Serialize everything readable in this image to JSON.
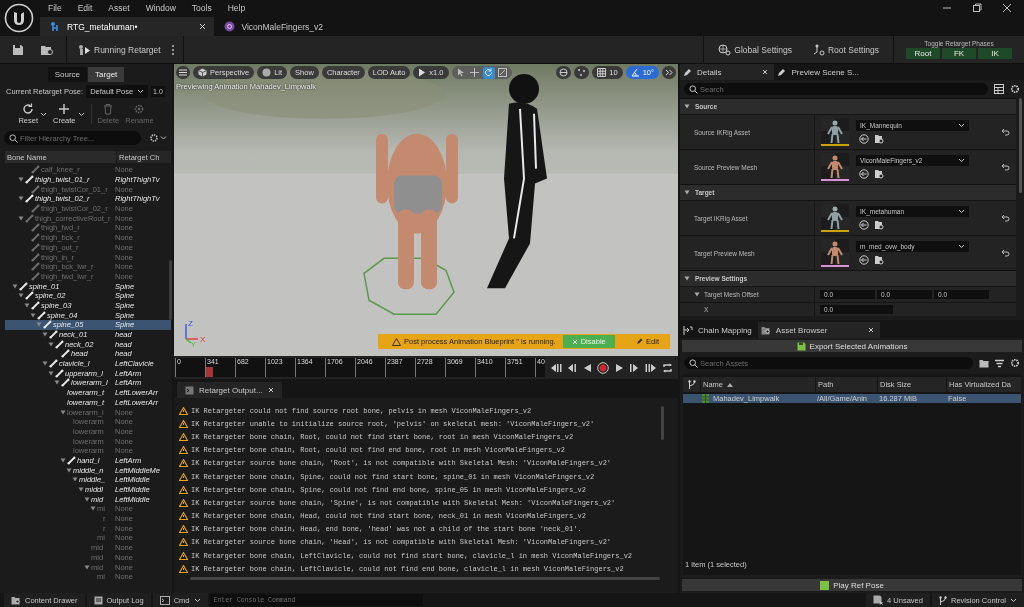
{
  "menu": [
    "File",
    "Edit",
    "Asset",
    "Window",
    "Tools",
    "Help"
  ],
  "doc_tabs": [
    {
      "label": "RTG_metahuman•",
      "selected": true
    },
    {
      "label": "ViconMaleFingers_v2",
      "selected": false
    }
  ],
  "toolbar": {
    "run_button": "Running Retarget",
    "global_settings": "Global Settings",
    "root_settings": "Root Settings",
    "phases_title": "Toggle Retarget Phases",
    "phases": [
      {
        "label": "Root",
        "on": true
      },
      {
        "label": "FK",
        "on": true
      },
      {
        "label": "IK",
        "on": true
      }
    ]
  },
  "left_panel": {
    "modes": [
      {
        "label": "Source",
        "selected": false
      },
      {
        "label": "Target",
        "selected": true
      }
    ],
    "pose_label": "Current Retarget Pose:",
    "pose_value": "Default Pose",
    "pose_scale": "1.0",
    "actions": [
      {
        "label": "Reset",
        "disabled": false
      },
      {
        "label": "Create",
        "disabled": false
      },
      {
        "label": "Delete",
        "disabled": true
      },
      {
        "label": "Rename",
        "disabled": true
      }
    ],
    "filter_placeholder": "Filter Hierarchy Tree...",
    "columns": [
      "Bone Name",
      "Retarget Ch"
    ],
    "tree": [
      {
        "children": [
          {
            "children": [
              {
                "name": "calf_knee_r",
                "chain": "None",
                "mapped": false,
                "icon": true,
                "selected": false
              }
            ]
          },
          {
            "name": "thigh_twist_01_r",
            "chain": "RightThighTv",
            "mapped": true,
            "icon": true,
            "selected": false,
            "children": [
              {
                "name": "thigh_twistCor_01_r",
                "chain": "None",
                "mapped": false,
                "icon": true,
                "selected": false
              }
            ]
          },
          {
            "name": "thigh_twist_02_r",
            "chain": "RightThighTv",
            "mapped": true,
            "icon": true,
            "selected": false,
            "children": [
              {
                "name": "thigh_twistCor_02_r",
                "chain": "None",
                "mapped": false,
                "icon": true,
                "selected": false
              }
            ]
          },
          {
            "name": "thigh_correctiveRoot_r",
            "chain": "None",
            "mapped": false,
            "icon": true,
            "selected": false,
            "children": [
              {
                "name": "thigh_fwd_r",
                "chain": "None",
                "mapped": false,
                "icon": true,
                "selected": false
              },
              {
                "name": "thigh_bck_r",
                "chain": "None",
                "mapped": false,
                "icon": true,
                "selected": false
              },
              {
                "name": "thigh_out_r",
                "chain": "None",
                "mapped": false,
                "icon": true,
                "selected": false
              },
              {
                "name": "thigh_in_r",
                "chain": "None",
                "mapped": false,
                "icon": true,
                "selected": false
              },
              {
                "name": "thigh_bck_lwr_r",
                "chain": "None",
                "mapped": false,
                "icon": true,
                "selected": false
              },
              {
                "name": "thigh_fwd_lwr_r",
                "chain": "None",
                "mapped": false,
                "icon": true,
                "selected": false
              }
            ]
          }
        ]
      },
      {
        "name": "spine_01",
        "chain": "Spine",
        "mapped": true,
        "icon": true,
        "selected": false,
        "children": [
          {
            "name": "spine_02",
            "chain": "Spine",
            "mapped": true,
            "icon": true,
            "selected": false,
            "children": [
              {
                "name": "spine_03",
                "chain": "Spine",
                "mapped": true,
                "icon": true,
                "selected": false,
                "children": [
                  {
                    "name": "spine_04",
                    "chain": "Spine",
                    "mapped": true,
                    "icon": true,
                    "selected": false,
                    "children": [
                      {
                        "name": "spine_05",
                        "chain": "Spine",
                        "mapped": true,
                        "icon": true,
                        "selected": true,
                        "children": [
                          {
                            "name": "neck_01",
                            "chain": "head",
                            "mapped": true,
                            "icon": true,
                            "selected": false,
                            "children": [
                              {
                                "name": "neck_02",
                                "chain": "head",
                                "mapped": true,
                                "icon": true,
                                "selected": false,
                                "children": [
                                  {
                                    "name": "head",
                                    "chain": "head",
                                    "mapped": true,
                                    "icon": true,
                                    "selected": false
                                  }
                                ]
                              }
                            ]
                          },
                          {
                            "name": "clavicle_l",
                            "chain": "LeftClavicle",
                            "mapped": true,
                            "icon": true,
                            "selected": false,
                            "children": [
                              {
                                "name": "upperarm_l",
                                "chain": "LeftArm",
                                "mapped": true,
                                "icon": true,
                                "selected": false,
                                "children": [
                                  {
                                    "name": "lowerarm_l",
                                    "chain": "LeftArm",
                                    "mapped": true,
                                    "icon": true,
                                    "selected": false,
                                    "children": [
                                      {
                                        "name": "lowerarm_t",
                                        "chain": "LeftLowerArr",
                                        "mapped": true,
                                        "icon": false,
                                        "selected": false
                                      },
                                      {
                                        "name": "lowerarm_t",
                                        "chain": "LeftLowerArr",
                                        "mapped": true,
                                        "icon": false,
                                        "selected": false
                                      },
                                      {
                                        "name": "lowerarm_i",
                                        "chain": "None",
                                        "mapped": false,
                                        "icon": false,
                                        "selected": false,
                                        "children": [
                                          {
                                            "name": "lowerarm",
                                            "chain": "None",
                                            "mapped": false,
                                            "icon": false,
                                            "selected": false
                                          },
                                          {
                                            "name": "lowerarm",
                                            "chain": "None",
                                            "mapped": false,
                                            "icon": false,
                                            "selected": false
                                          },
                                          {
                                            "name": "lowerarm",
                                            "chain": "None",
                                            "mapped": false,
                                            "icon": false,
                                            "selected": false
                                          },
                                          {
                                            "name": "lowerarm",
                                            "chain": "None",
                                            "mapped": false,
                                            "icon": false,
                                            "selected": false
                                          }
                                        ]
                                      },
                                      {
                                        "name": "hand_l",
                                        "chain": "LeftArm",
                                        "mapped": true,
                                        "icon": true,
                                        "selected": false,
                                        "children": [
                                          {
                                            "name": "middle_n",
                                            "chain": "LeftMiddleMe",
                                            "mapped": true,
                                            "icon": false,
                                            "selected": false,
                                            "children": [
                                              {
                                                "name": "middle_",
                                                "chain": "LeftMiddle",
                                                "mapped": true,
                                                "icon": false,
                                                "selected": false,
                                                "children": [
                                                  {
                                                    "name": "middl",
                                                    "chain": "LeftMiddle",
                                                    "mapped": true,
                                                    "icon": false,
                                                    "selected": false,
                                                    "children": [
                                                      {
                                                        "name": "mid",
                                                        "chain": "LeftMiddle",
                                                        "mapped": true,
                                                        "icon": false,
                                                        "selected": false,
                                                        "children": [
                                                          {
                                                            "name": "mi",
                                                            "chain": "None",
                                                            "mapped": false,
                                                            "icon": false,
                                                            "selected": false,
                                                            "children": [
                                                              {
                                                                "name": "r",
                                                                "chain": "None",
                                                                "mapped": false,
                                                                "icon": false,
                                                                "selected": false
                                                              },
                                                              {
                                                                "name": "r",
                                                                "chain": "None",
                                                                "mapped": false,
                                                                "icon": false,
                                                                "selected": false
                                                              }
                                                            ]
                                                          },
                                                          {
                                                            "name": "mi",
                                                            "chain": "None",
                                                            "mapped": false,
                                                            "icon": false,
                                                            "selected": false
                                                          }
                                                        ]
                                                      },
                                                      {
                                                        "name": "mid",
                                                        "chain": "None",
                                                        "mapped": false,
                                                        "icon": false,
                                                        "selected": false
                                                      },
                                                      {
                                                        "name": "mid",
                                                        "chain": "None",
                                                        "mapped": false,
                                                        "icon": false,
                                                        "selected": false
                                                      },
                                                      {
                                                        "name": "mid",
                                                        "chain": "None",
                                                        "mapped": false,
                                                        "icon": false,
                                                        "selected": false,
                                                        "children": [
                                                          {
                                                            "name": "mi",
                                                            "chain": "None",
                                                            "mapped": false,
                                                            "icon": false,
                                                            "selected": false
                                                          }
                                                        ]
                                                      }
                                                    ]
                                                  }
                                                ]
                                              }
                                            ]
                                          }
                                        ]
                                      }
                                    ]
                                  }
                                ]
                              }
                            ]
                          }
                        ]
                      }
                    ]
                  }
                ]
              }
            ]
          }
        ]
      }
    ]
  },
  "viewport": {
    "view_mode": "Perspective",
    "lighting": "Lit",
    "show": "Show",
    "character": "Character",
    "lod": "LOD Auto",
    "speed": "x1.0",
    "transform_tools": [
      {
        "kind": "select",
        "selected": false
      },
      {
        "kind": "move",
        "selected": false
      },
      {
        "kind": "rotate",
        "selected": true
      },
      {
        "kind": "scale",
        "selected": false
      }
    ],
    "grid_snap": {
      "value": "10",
      "on": false
    },
    "angle_snap": {
      "value": "10°",
      "on": true
    },
    "caption": "Previewing Animation Mahadev_Limpwalk",
    "axis_labels": {
      "z": "Z",
      "x": "X",
      "y": "Y"
    },
    "notice": {
      "text": "Post process Animation Blueprint '' is running.",
      "disable": "Disable",
      "edit": "Edit"
    }
  },
  "timeline": {
    "ticks": [
      "0",
      "341",
      "682",
      "1023",
      "1364",
      "1706",
      "2046",
      "2387",
      "2728",
      "3069",
      "3410",
      "3751",
      "40"
    ],
    "playhead": {
      "level": 0.083
    }
  },
  "output_tab": "Retarget Output...",
  "log": [
    {
      "kind": "warning",
      "text": "IK Retargeter could not find source root bone, pelvis in mesh ViconMaleFingers_v2"
    },
    {
      "kind": "warning",
      "text": "IK Retargeter unable to initialize source root, 'pelvis' on skeletal mesh: 'ViconMaleFingers_v2'"
    },
    {
      "kind": "warning",
      "text": "IK Retargeter bone chain, Root, could not find start bone, root in mesh ViconMaleFingers_v2"
    },
    {
      "kind": "warning",
      "text": "IK Retargeter bone chain, Root, could not find end bone, root in mesh ViconMaleFingers_v2"
    },
    {
      "kind": "warning",
      "text": "IK Retargeter source bone chain, 'Root', is not compatible with Skeletal Mesh: 'ViconMaleFingers_v2'"
    },
    {
      "kind": "warning",
      "text": "IK Retargeter bone chain, Spine, could not find start bone, spine_01 in mesh ViconMaleFingers_v2"
    },
    {
      "kind": "warning",
      "text": "IK Retargeter bone chain, Spine, could not find end bone, spine_05 in mesh ViconMaleFingers_v2"
    },
    {
      "kind": "warning",
      "text": "IK Retargeter source bone chain, 'Spine', is not compatible with Skeletal Mesh: 'ViconMaleFingers_v2'"
    },
    {
      "kind": "warning",
      "text": "IK Retargeter bone chain, Head, could not find start bone, neck_01 in mesh ViconMaleFingers_v2"
    },
    {
      "kind": "warning",
      "text": "IK Retargeter bone chain, Head, end bone, 'head' was not a child of the start bone 'neck_01'."
    },
    {
      "kind": "warning",
      "text": "IK Retargeter source bone chain, 'Head', is not compatible with Skeletal Mesh: 'ViconMaleFingers_v2'"
    },
    {
      "kind": "warning",
      "text": "IK Retargeter bone chain, LeftClavicle, could not find start bone, clavicle_l in mesh ViconMaleFingers_v2"
    },
    {
      "kind": "warning",
      "text": "IK Retargeter bone chain, LeftClavicle, could not find end bone, clavicle_l in mesh ViconMaleFingers_v2"
    }
  ],
  "details": {
    "tabs": [
      {
        "label": "Details",
        "selected": true
      },
      {
        "label": "Preview Scene S...",
        "selected": false
      }
    ],
    "search_placeholder": "Search",
    "sections": [
      {
        "title": "Source",
        "props": [
          {
            "kind": "asset",
            "label": "Source IKRig Asset",
            "value": "IK_Mannequin",
            "color": "#c9a400"
          },
          {
            "kind": "asset",
            "label": "Source Preview Mesh",
            "value": "ViconMaleFingers_v2",
            "color": "#d98fd9"
          }
        ]
      },
      {
        "title": "Target",
        "props": [
          {
            "kind": "asset",
            "label": "Target IKRig Asset",
            "value": "IK_metahuman",
            "color": "#c9a400"
          },
          {
            "kind": "asset",
            "label": "Target Preview Mesh",
            "value": "m_med_ovw_body",
            "color": "#d98fd9"
          }
        ]
      },
      {
        "title": "Preview Settings",
        "props": [
          {
            "kind": "vector",
            "label": "Target Mesh Offset",
            "values": [
              "0.0",
              "0.0",
              "0.0"
            ]
          },
          {
            "kind": "number",
            "label": "X",
            "value": "0.0"
          }
        ]
      }
    ]
  },
  "bottom_tabs": [
    {
      "label": "Chain Mapping",
      "selected": false
    },
    {
      "label": "Asset Browser",
      "selected": true
    }
  ],
  "export_button": "Export Selected Animations",
  "asset_search_placeholder": "Search Assets",
  "asset_columns": [
    "Name",
    "Path",
    "Disk Size",
    "Has Virtualized Da"
  ],
  "assets": [
    {
      "cells": [
        "Mahadev_Limpwalk",
        "/All/Game/Anin",
        "16.287 MiB",
        "False"
      ],
      "selected": true
    }
  ],
  "asset_count": "1 item (1 selected)",
  "play_ref_pose": "Play Ref Pose",
  "status_bar": {
    "content_drawer": "Content Drawer",
    "output_log": "Output Log",
    "cmd": "Cmd",
    "console_placeholder": "Enter Console Command",
    "unsaved": "4 Unsaved",
    "revision_control": "Revision Control"
  }
}
